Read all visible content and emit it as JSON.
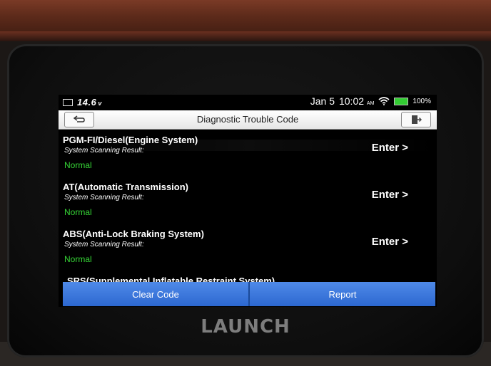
{
  "device": {
    "brand": "LAUNCH"
  },
  "status_bar": {
    "voltage": "14.6",
    "voltage_unit": "v",
    "date": "Jan 5",
    "time": "10:02",
    "ampm": "AM",
    "battery_percent": "100%",
    "icons": [
      "battery-small-icon",
      "wifi-icon",
      "battery-icon"
    ]
  },
  "header": {
    "title": "Diagnostic Trouble Code",
    "back_icon": "back-arrow-icon",
    "exit_icon": "exit-door-icon"
  },
  "systems": [
    {
      "name": "PGM-FI/Diesel(Engine System)",
      "label": "System Scanning Result:",
      "status": "Normal",
      "action": "Enter >"
    },
    {
      "name": "AT(Automatic Transmission)",
      "label": "System Scanning Result:",
      "status": "Normal",
      "action": "Enter >"
    },
    {
      "name": "ABS(Anti-Lock Braking System)",
      "label": "System Scanning Result:",
      "status": "Normal",
      "action": "Enter >"
    }
  ],
  "partial_item": "SRS(Supplemental Inflatable Restraint System)",
  "bottom_buttons": {
    "clear": "Clear Code",
    "report": "Report"
  },
  "colors": {
    "accent": "#2f6fd8",
    "status_ok": "#36d636"
  }
}
